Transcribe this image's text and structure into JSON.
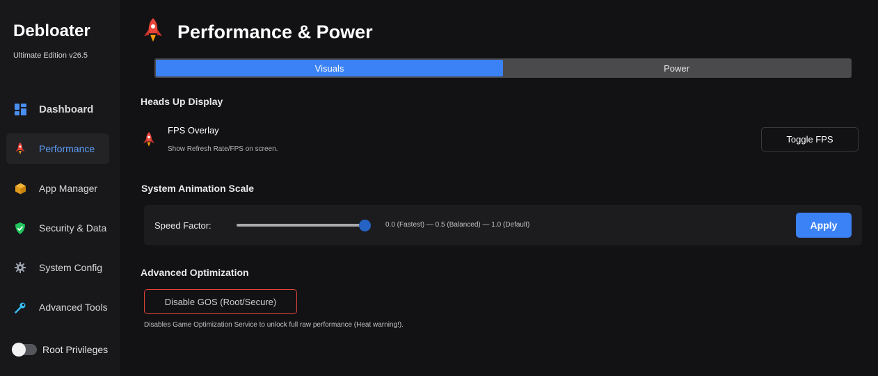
{
  "sidebar": {
    "app_title": "Debloater",
    "app_subtitle": "Ultimate Edition v26.5",
    "items": [
      {
        "label": "Dashboard",
        "icon": "dashboard-icon"
      },
      {
        "label": "Performance",
        "icon": "rocket-icon"
      },
      {
        "label": "App Manager",
        "icon": "package-icon"
      },
      {
        "label": "Security & Data",
        "icon": "shield-icon"
      },
      {
        "label": "System Config",
        "icon": "gear-icon"
      },
      {
        "label": "Advanced Tools",
        "icon": "wrench-icon"
      }
    ],
    "root_label": "Root Privileges",
    "root_enabled": false
  },
  "header": {
    "title": "Performance & Power",
    "icon": "rocket-icon"
  },
  "tabs": [
    {
      "label": "Visuals",
      "active": true
    },
    {
      "label": "Power",
      "active": false
    }
  ],
  "hud": {
    "section_title": "Heads Up Display",
    "fps_title": "FPS Overlay",
    "fps_desc": "Show Refresh Rate/FPS on screen.",
    "toggle_label": "Toggle FPS"
  },
  "animation": {
    "section_title": "System Animation Scale",
    "speed_label": "Speed Factor:",
    "slider_value": 1.0,
    "slider_min": 0.0,
    "slider_max": 1.0,
    "hint": "0.0 (Fastest)  —  0.5 (Balanced)  —  1.0 (Default)",
    "apply_label": "Apply"
  },
  "advanced": {
    "section_title": "Advanced Optimization",
    "button_label": "Disable GOS (Root/Secure)",
    "desc": "Disables Game Optimization Service to unlock full raw performance (Heat warning!)."
  },
  "colors": {
    "accent": "#3b82f6",
    "danger": "#e0453a",
    "background": "#121214",
    "sidebar": "#18181b"
  }
}
